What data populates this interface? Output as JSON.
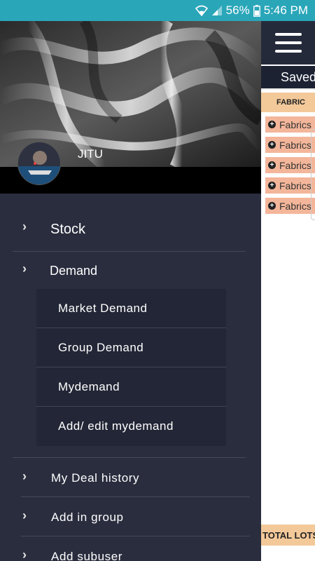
{
  "status_bar": {
    "battery": "56%",
    "time": "5:46 PM",
    "wifi_icon": "wifi-icon",
    "signal_icon": "signal-icon",
    "battery_icon": "battery-icon"
  },
  "drawer": {
    "user": {
      "name": "JITU"
    },
    "menu": {
      "stock": "Stock",
      "demand": "Demand",
      "demand_sub": [
        "Market Demand",
        "Group Demand",
        "Mydemand",
        "Add/ edit mydemand"
      ],
      "deal_history": "My Deal history",
      "add_group": "Add in group",
      "add_subuser": "Add subuser"
    }
  },
  "background_app": {
    "menu_icon": "hamburger-icon",
    "saved_tab": "Saved",
    "fabric_header": "FABRIC",
    "fabric_items": [
      "Fabrics",
      "Fabrics",
      "Fabrics",
      "Fabrics",
      "Fabrics"
    ],
    "total_label": "TOTAL LOTS"
  },
  "colors": {
    "status_bar": "#2aa6b9",
    "drawer_bg": "#2a2d3e",
    "submenu_bg": "#232636",
    "header_peach": "#f3c99a",
    "row_peach": "#f4b69a"
  }
}
